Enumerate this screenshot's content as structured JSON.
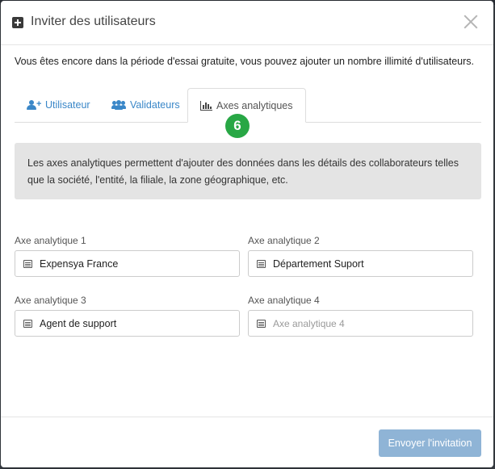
{
  "modal": {
    "title": "Inviter des utilisateurs",
    "intro": "Vous êtes encore dans la période d'essai gratuite, vous pouvez ajouter un nombre illimité d'utilisateurs."
  },
  "tabs": [
    {
      "label": "Utilisateur",
      "icon": "user-plus-icon",
      "active": false
    },
    {
      "label": "Validateurs",
      "icon": "users-icon",
      "active": false
    },
    {
      "label": "Axes analytiques",
      "icon": "bar-chart-icon",
      "active": true
    }
  ],
  "step_badge": "6",
  "info_text": "Les axes analytiques permettent d'ajouter des données dans les détails des collaborateurs telles que la société, l'entité, la filiale, la zone géographique, etc.",
  "fields": [
    {
      "label": "Axe analytique 1",
      "value": "Expensya France",
      "placeholder": "Axe analytique 1"
    },
    {
      "label": "Axe analytique 2",
      "value": "Département Suport",
      "placeholder": "Axe analytique 2"
    },
    {
      "label": "Axe analytique 3",
      "value": "Agent de support",
      "placeholder": "Axe analytique 3"
    },
    {
      "label": "Axe analytique 4",
      "value": "",
      "placeholder": "Axe analytique 4"
    }
  ],
  "footer": {
    "send_label": "Envoyer l'invitation"
  },
  "colors": {
    "accent": "#3a87c8",
    "badge": "#28a745",
    "button": "#8fb4d6",
    "info_bg": "#e4e4e4"
  }
}
